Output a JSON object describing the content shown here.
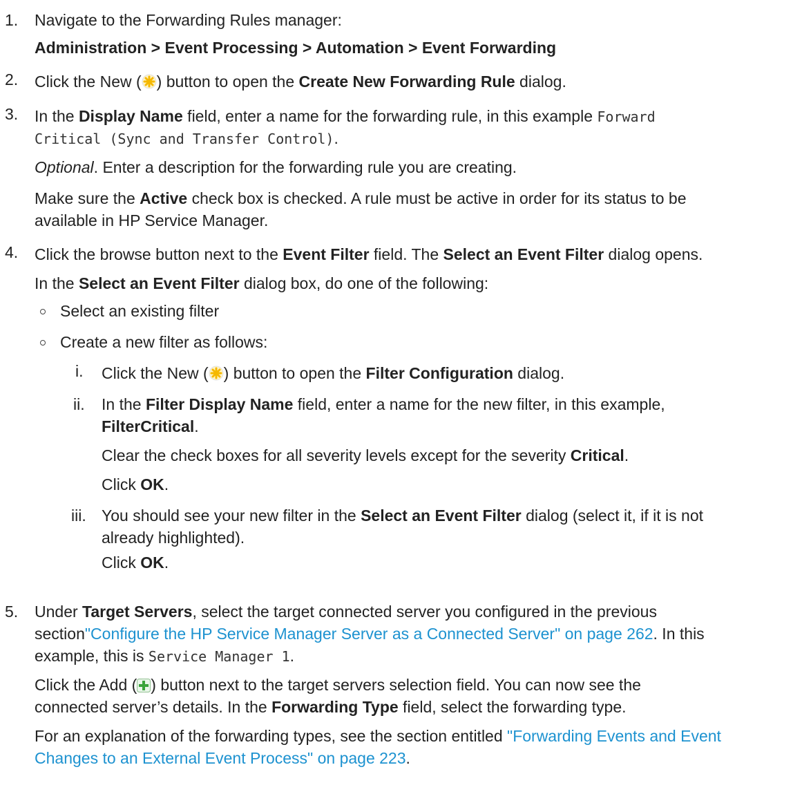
{
  "step1": {
    "num": "1.",
    "text": "Navigate to the Forwarding Rules manager:",
    "path": "Administration > Event Processing > Automation > Event Forwarding"
  },
  "step2": {
    "num": "2.",
    "t1": "Click the New (",
    "icon": "new-star-icon",
    "t2": ") button to open the ",
    "b1": "Create New Forwarding Rule",
    "t3": " dialog."
  },
  "step3": {
    "num": "3.",
    "t1": "In the ",
    "b1": "Display Name",
    "t2": " field, enter a name for the forwarding rule, in this example ",
    "code1": "Forward",
    "code2": "Critical (Sync and Transfer Control)",
    "t3": ".",
    "opt_italic": "Optional",
    "opt_text": ". Enter a description for the forwarding rule you are creating.",
    "p1": "Make sure the ",
    "p1_b": "Active",
    "p1_t": " check box is checked. A rule must be active in order for its status to be",
    "p2": "available in HP Service Manager."
  },
  "step4": {
    "num": "4.",
    "t1": "Click the browse button next to the ",
    "b1": "Event Filter",
    "t2": " field. The ",
    "b2": "Select an Event Filter",
    "t3": " dialog opens.",
    "s1": "In the ",
    "s1_b": "Select an Event Filter",
    "s1_t": " dialog box, do one of the following:",
    "bullet1": "Select an existing filter",
    "bullet2": "Create a new filter as follows:",
    "sub_i": {
      "num": "i.",
      "t1": "Click the New (",
      "t2": ") button to open the ",
      "b1": "Filter Configuration",
      "t3": " dialog."
    },
    "sub_ii": {
      "num": "ii.",
      "t1": "In the ",
      "b1": "Filter Display Name",
      "t2": " field, enter a name for the new filter, in this example,",
      "b2": "FilterCritical",
      "t3": ".",
      "c1": "Clear the check boxes for all severity levels except for the severity ",
      "c1_b": "Critical",
      "c1_t": ".",
      "ok1": "Click ",
      "ok1_b": "OK",
      "ok1_t": "."
    },
    "sub_iii": {
      "num": "iii.",
      "t1": "You should see your new filter in the ",
      "b1": "Select an Event Filter",
      "t2": " dialog (select it, if it is not",
      "t3": "already highlighted).",
      "ok": "Click ",
      "ok_b": "OK",
      "ok_t": "."
    }
  },
  "step5": {
    "num": "5.",
    "t1": "Under ",
    "b1": "Target Servers",
    "t2": ", select the target connected server you configured in the previous",
    "t3": "section",
    "link1": "\"Configure the HP Service Manager Server as a Connected Server\" on page 262",
    "t4": ". In this",
    "t5": "example, this is ",
    "code1": "Service Manager 1",
    "t6": ".",
    "a1": "Click the Add (",
    "a2": ") button next to the target servers selection field. You can now see the",
    "a3": "connected server’s details. In the ",
    "a3_b": "Forwarding Type",
    "a3_t": " field, select the forwarding type.",
    "e1": "For an explanation of the forwarding types, see the section entitled ",
    "link2a": "\"Forwarding Events and Event",
    "link2b": "Changes to an External Event Process\" on page 223",
    "e2": "."
  },
  "colors": {
    "link": "#1d92d0",
    "text": "#222222",
    "icon_new": "#f5b800",
    "icon_add": "#3aa43a"
  }
}
